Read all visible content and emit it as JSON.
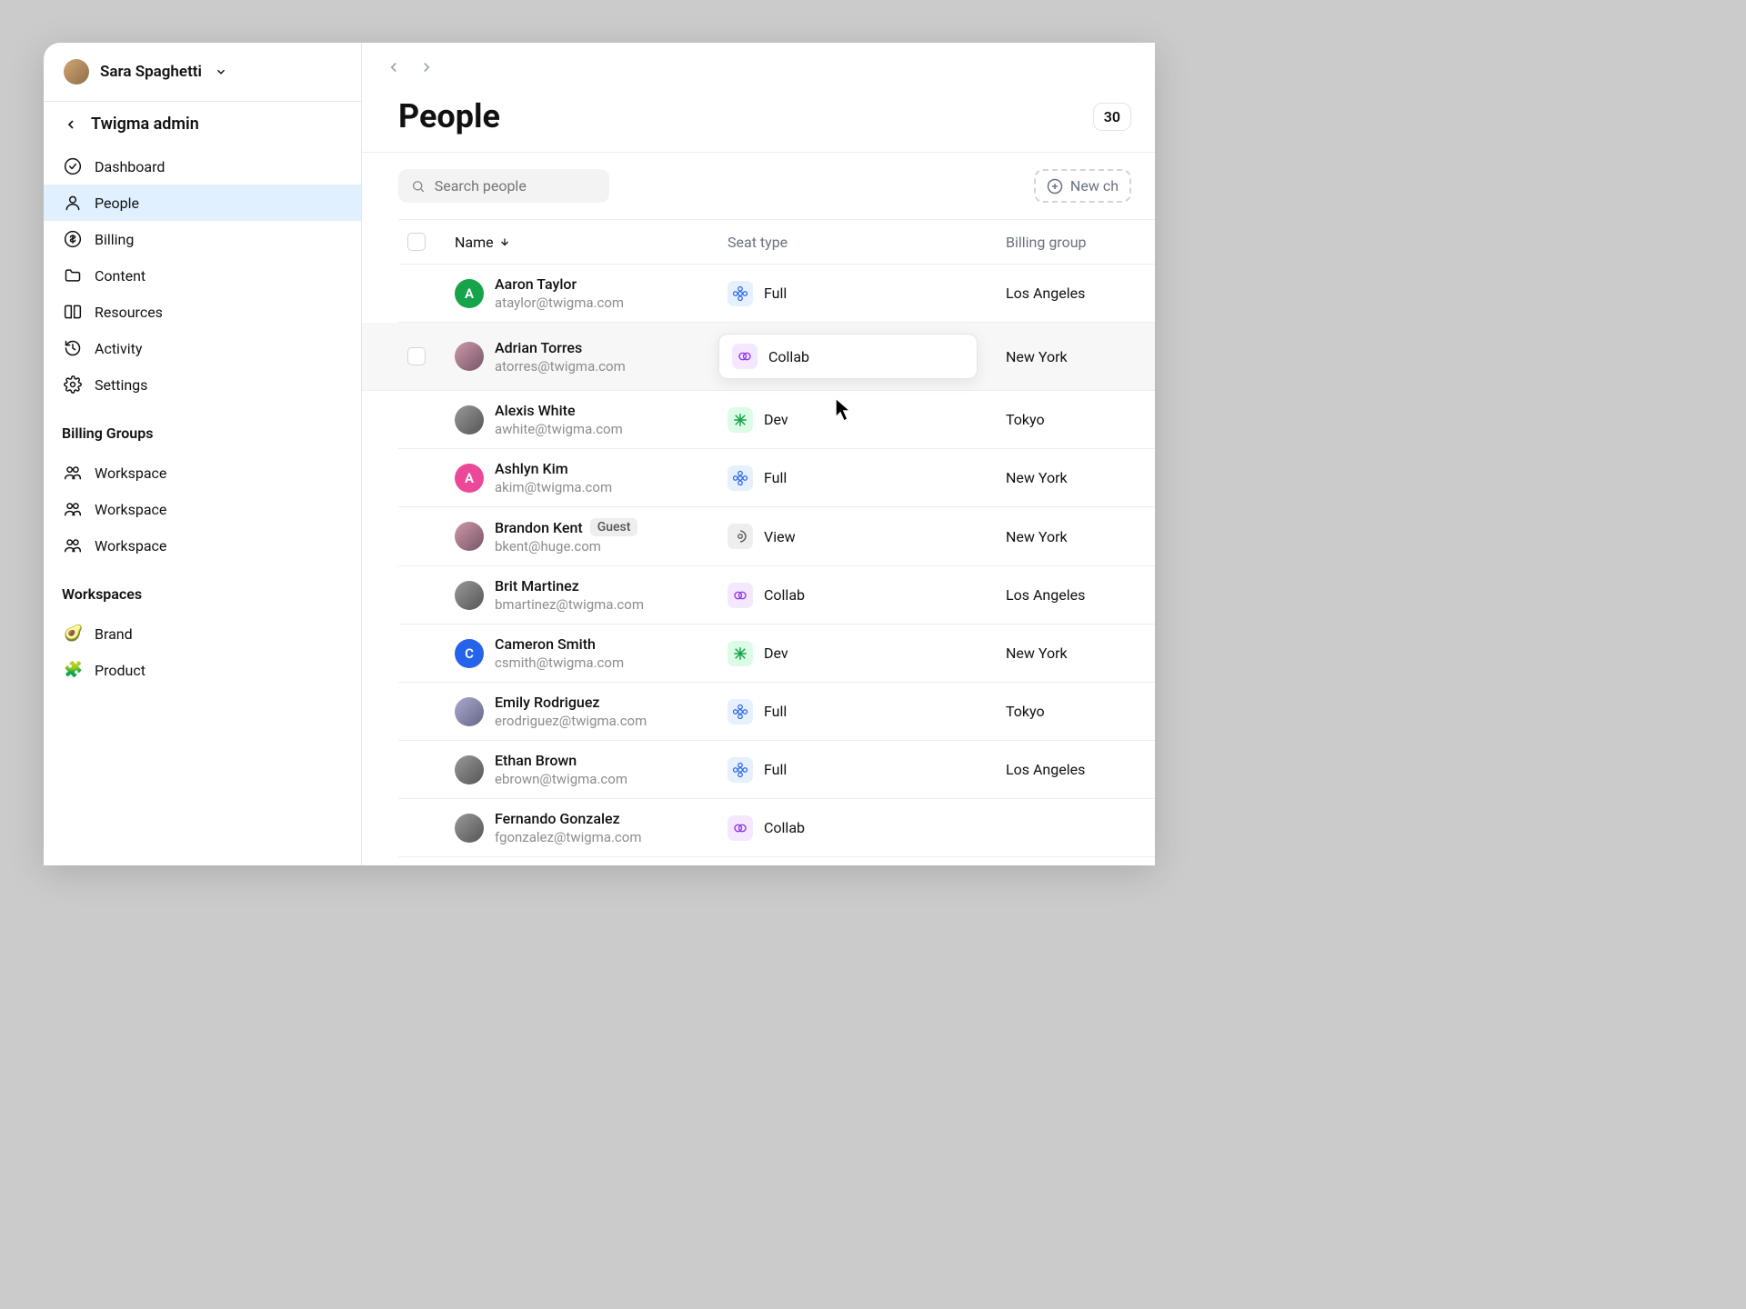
{
  "user": {
    "name": "Sara Spaghetti"
  },
  "sidebar": {
    "back_label": "Twigma admin",
    "items": [
      {
        "label": "Dashboard",
        "icon": "check-circle"
      },
      {
        "label": "People",
        "icon": "person",
        "active": true
      },
      {
        "label": "Billing",
        "icon": "dollar"
      },
      {
        "label": "Content",
        "icon": "folder"
      },
      {
        "label": "Resources",
        "icon": "book"
      },
      {
        "label": "Activity",
        "icon": "history"
      },
      {
        "label": "Settings",
        "icon": "gear"
      }
    ],
    "billing_groups_label": "Billing Groups",
    "billing_groups": [
      {
        "label": "Workspace"
      },
      {
        "label": "Workspace"
      },
      {
        "label": "Workspace"
      }
    ],
    "workspaces_label": "Workspaces",
    "workspaces": [
      {
        "emoji": "🥑",
        "label": "Brand"
      },
      {
        "emoji": "🧩",
        "label": "Product"
      }
    ]
  },
  "page": {
    "title": "People",
    "count": "30",
    "search_placeholder": "Search people",
    "new_button": "New ch"
  },
  "table": {
    "headers": {
      "name": "Name",
      "seat": "Seat type",
      "billing": "Billing group"
    },
    "rows": [
      {
        "name": "Aaron Taylor",
        "email": "ataylor@twigma.com",
        "initial": "A",
        "color": "#16a34a",
        "seat": "Full",
        "seat_kind": "full",
        "billing": "Los Angeles"
      },
      {
        "name": "Adrian Torres",
        "email": "atorres@twigma.com",
        "photo": true,
        "seat": "Collab",
        "seat_kind": "collab",
        "billing": "New York",
        "hover": true
      },
      {
        "name": "Alexis White",
        "email": "awhite@twigma.com",
        "photo": true,
        "seat": "Dev",
        "seat_kind": "dev",
        "billing": "Tokyo"
      },
      {
        "name": "Ashlyn Kim",
        "email": "akim@twigma.com",
        "initial": "A",
        "color": "#ec4899",
        "seat": "Full",
        "seat_kind": "full",
        "billing": "New York"
      },
      {
        "name": "Brandon Kent",
        "email": "bkent@huge.com",
        "photo": true,
        "guest": "Guest",
        "seat": "View",
        "seat_kind": "view",
        "billing": "New York"
      },
      {
        "name": "Brit Martinez",
        "email": "bmartinez@twigma.com",
        "photo": true,
        "seat": "Collab",
        "seat_kind": "collab",
        "billing": "Los Angeles"
      },
      {
        "name": "Cameron Smith",
        "email": "csmith@twigma.com",
        "initial": "C",
        "color": "#2563eb",
        "seat": "Dev",
        "seat_kind": "dev",
        "billing": "New York"
      },
      {
        "name": "Emily Rodriguez",
        "email": "erodriguez@twigma.com",
        "photo": true,
        "seat": "Full",
        "seat_kind": "full",
        "billing": "Tokyo"
      },
      {
        "name": "Ethan Brown",
        "email": "ebrown@twigma.com",
        "photo": true,
        "seat": "Full",
        "seat_kind": "full",
        "billing": "Los Angeles"
      },
      {
        "name": "Fernando Gonzalez",
        "email": "fgonzalez@twigma.com",
        "photo": true,
        "seat": "Collab",
        "seat_kind": "collab",
        "billing": ""
      }
    ]
  }
}
